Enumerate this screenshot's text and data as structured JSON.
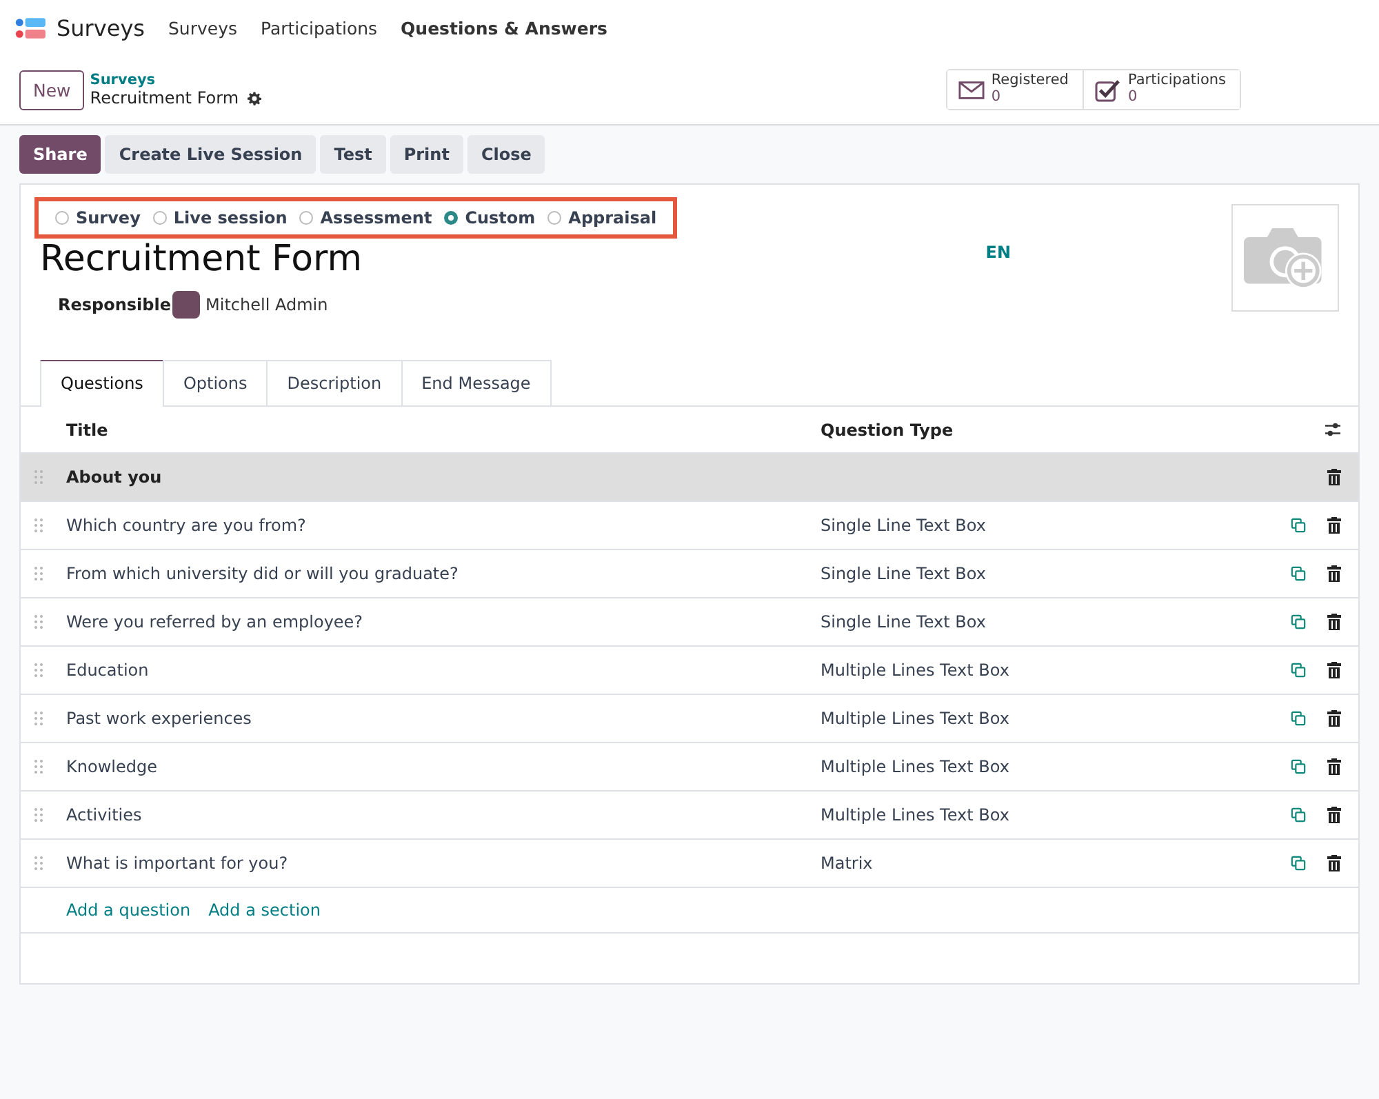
{
  "navbar": {
    "app_name": "Surveys",
    "menu": [
      {
        "label": "Surveys",
        "selected": false
      },
      {
        "label": "Participations",
        "selected": false
      },
      {
        "label": "Questions & Answers",
        "selected": true
      }
    ]
  },
  "control_panel": {
    "new_button": "New",
    "breadcrumb": "Surveys",
    "record": "Recruitment Form",
    "stats": [
      {
        "kind": "mail",
        "label": "Registered",
        "value": "0"
      },
      {
        "kind": "check",
        "label": "Participations",
        "value": "0"
      }
    ]
  },
  "actions": [
    {
      "label": "Share",
      "kind": "primary"
    },
    {
      "label": "Create Live Session",
      "kind": "secondary"
    },
    {
      "label": "Test",
      "kind": "secondary"
    },
    {
      "label": "Print",
      "kind": "secondary"
    },
    {
      "label": "Close",
      "kind": "secondary"
    }
  ],
  "survey_types": [
    {
      "label": "Survey",
      "selected": false
    },
    {
      "label": "Live session",
      "selected": false
    },
    {
      "label": "Assessment",
      "selected": false
    },
    {
      "label": "Custom",
      "selected": true
    },
    {
      "label": "Appraisal",
      "selected": false
    }
  ],
  "title": "Recruitment Form",
  "language": "EN",
  "responsible": {
    "label": "Responsible",
    "name": "Mitchell Admin"
  },
  "tabs": [
    {
      "label": "Questions",
      "selected": true
    },
    {
      "label": "Options",
      "selected": false
    },
    {
      "label": "Description",
      "selected": false
    },
    {
      "label": "End Message",
      "selected": false
    }
  ],
  "table": {
    "columns": [
      "Title",
      "Question Type"
    ],
    "rows": [
      {
        "kind": "section",
        "title": "About you"
      },
      {
        "kind": "question",
        "title": "Which country are you from?",
        "type": "Single Line Text Box"
      },
      {
        "kind": "question",
        "title": "From which university did or will you graduate?",
        "type": "Single Line Text Box"
      },
      {
        "kind": "question",
        "title": "Were you referred by an employee?",
        "type": "Single Line Text Box"
      },
      {
        "kind": "question",
        "title": "Education",
        "type": "Multiple Lines Text Box"
      },
      {
        "kind": "question",
        "title": "Past work experiences",
        "type": "Multiple Lines Text Box"
      },
      {
        "kind": "question",
        "title": "Knowledge",
        "type": "Multiple Lines Text Box"
      },
      {
        "kind": "question",
        "title": "Activities",
        "type": "Multiple Lines Text Box"
      },
      {
        "kind": "question",
        "title": "What is important for you?",
        "type": "Matrix"
      }
    ],
    "add_links": [
      "Add a question",
      "Add a section"
    ]
  }
}
